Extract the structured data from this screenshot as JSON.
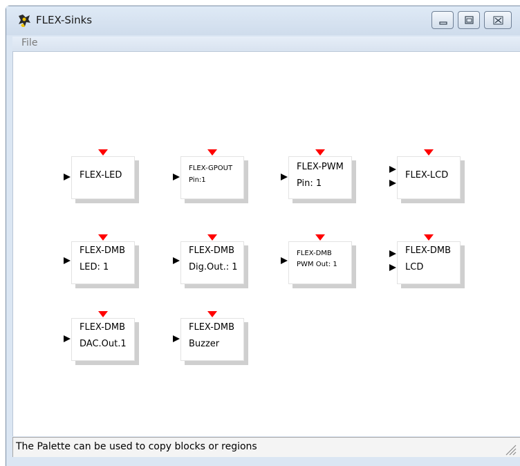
{
  "window": {
    "title": "FLEX-Sinks",
    "icon": "scilab-penguin-icon"
  },
  "caption_buttons": {
    "minimize_icon": "minimize-icon",
    "maximize_icon": "maximize-icon",
    "close_icon": "close-icon"
  },
  "menubar": {
    "file_label": "File"
  },
  "palette": {
    "blocks": [
      {
        "line1": "FLEX-LED",
        "line2": ""
      },
      {
        "line1": "FLEX-GPOUT",
        "line2": "Pin:1"
      },
      {
        "line1": "FLEX-PWM",
        "line2": "Pin: 1"
      },
      {
        "line1": "FLEX-LCD",
        "line2": ""
      },
      {
        "line1": "FLEX-DMB",
        "line2": "LED: 1"
      },
      {
        "line1": "FLEX-DMB",
        "line2": "Dig.Out.: 1"
      },
      {
        "line1": "FLEX-DMB",
        "line2": "PWM Out: 1"
      },
      {
        "line1": "FLEX-DMB",
        "line2": "LCD"
      },
      {
        "line1": "FLEX-DMB",
        "line2": "DAC.Out.1"
      },
      {
        "line1": "FLEX-DMB",
        "line2": "Buzzer"
      }
    ]
  },
  "statusbar": {
    "text": "The Palette can be used to copy blocks or regions"
  },
  "colors": {
    "event_port": "#ff0000",
    "data_port": "#000000",
    "block_shadow": "#cfcfcf"
  }
}
